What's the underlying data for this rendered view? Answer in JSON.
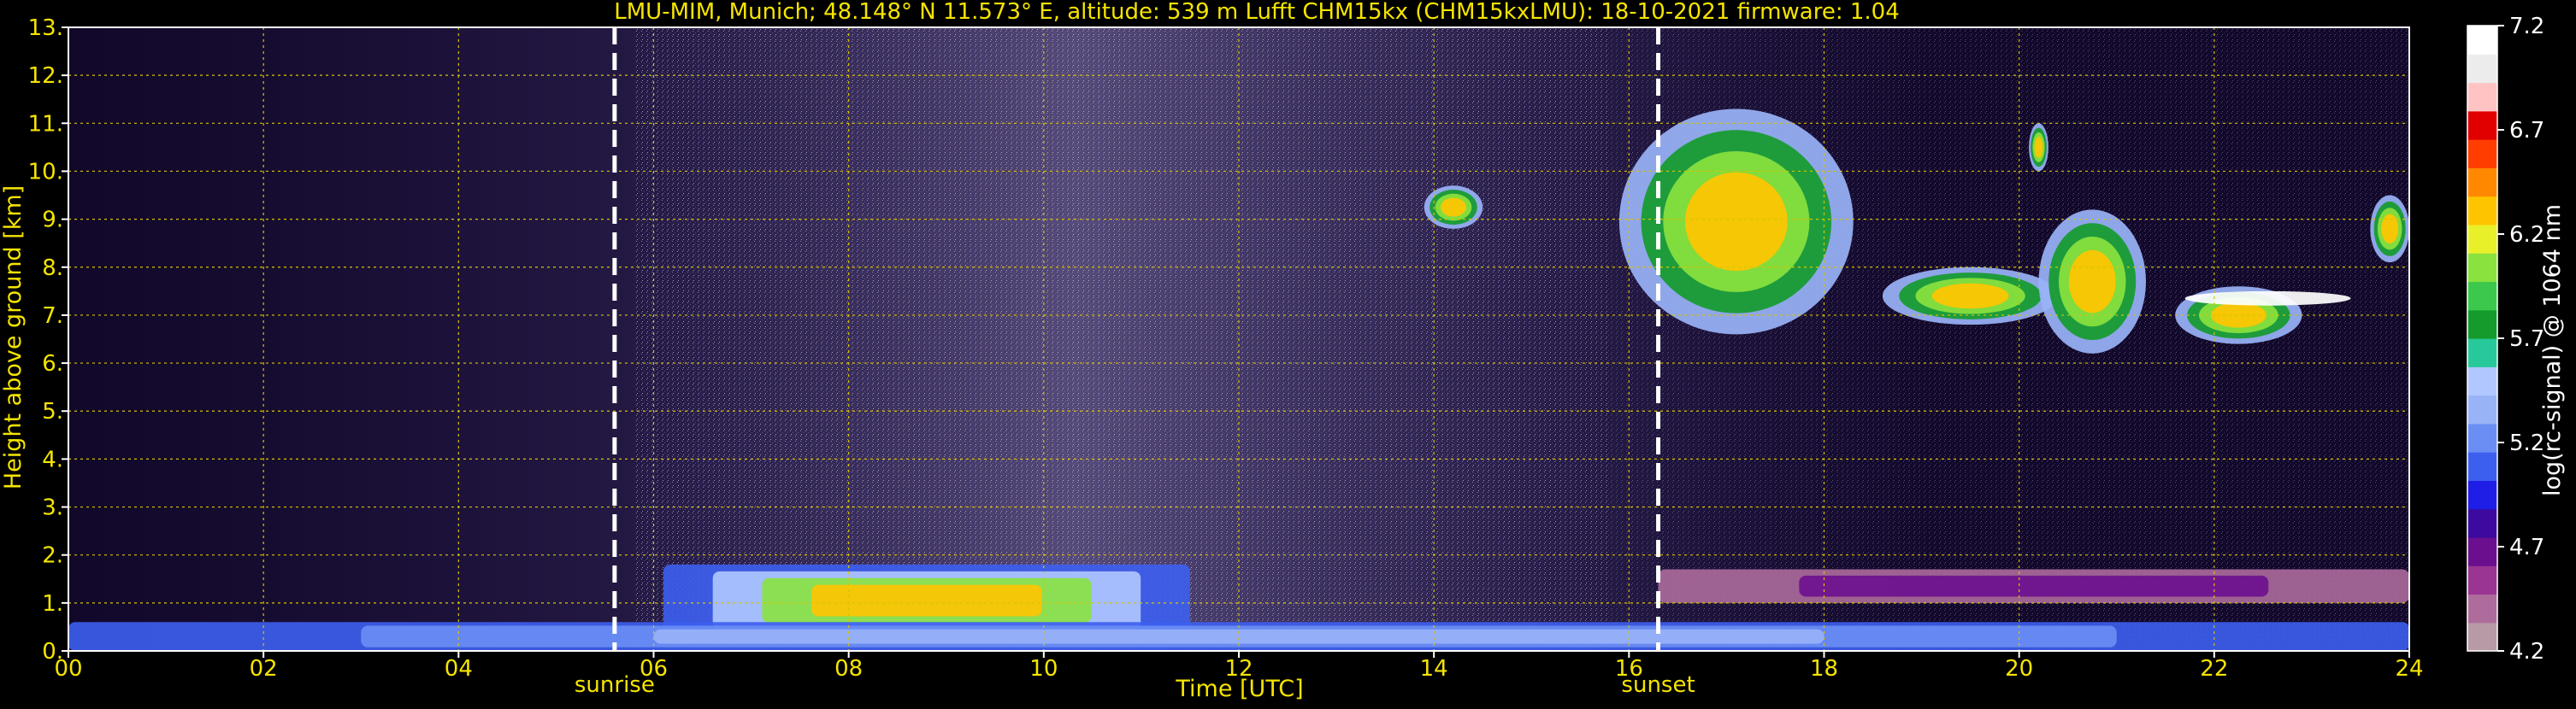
{
  "chart_data": {
    "type": "heatmap",
    "title": "LMU-MIM, Munich; 48.148° N 11.573° E, altitude: 539 m    Lufft CHM15kx (CHM15kxLMU): 18-10-2021    firmware: 1.04",
    "xlabel": "Time [UTC]",
    "ylabel": "Height above ground [km]",
    "xlim": [
      0,
      24
    ],
    "ylim": [
      0,
      13
    ],
    "x_ticks": [
      "00",
      "02",
      "04",
      "06",
      "08",
      "10",
      "12",
      "14",
      "16",
      "18",
      "20",
      "22",
      "24"
    ],
    "y_ticks": [
      "0.",
      "1.",
      "2.",
      "3.",
      "4.",
      "5.",
      "6.",
      "7.",
      "8.",
      "9.",
      "10.",
      "11.",
      "12.",
      "13."
    ],
    "grid": true,
    "colorbar": {
      "label": "log(rc-signal) @ 1064 nm",
      "range": [
        4.2,
        7.2
      ],
      "ticks": [
        "4.2",
        "4.7",
        "5.2",
        "5.7",
        "6.2",
        "6.7",
        "7.2"
      ]
    },
    "markers": [
      {
        "label": "sunrise",
        "time": 5.6
      },
      {
        "label": "sunset",
        "time": 16.3
      }
    ],
    "features": [
      {
        "kind": "boundary layer aerosol",
        "start": 6.1,
        "end": 11.5,
        "bottom": 0.3,
        "top": 1.8
      },
      {
        "kind": "near-surface layer",
        "start": 0.0,
        "end": 24.0,
        "bottom": 0.0,
        "top": 0.6
      },
      {
        "kind": "residual layer",
        "start": 16.3,
        "end": 24.0,
        "bottom": 1.0,
        "top": 1.7
      },
      {
        "kind": "cirrus",
        "start": 15.9,
        "end": 18.3,
        "bottom": 6.6,
        "top": 11.3
      },
      {
        "kind": "cirrus",
        "start": 18.6,
        "end": 20.4,
        "bottom": 6.8,
        "top": 8.0
      },
      {
        "kind": "cirrus",
        "start": 20.2,
        "end": 21.3,
        "bottom": 6.2,
        "top": 9.2
      },
      {
        "kind": "cirrus",
        "start": 20.1,
        "end": 20.3,
        "bottom": 10.0,
        "top": 11.0
      },
      {
        "kind": "cirrus",
        "start": 21.6,
        "end": 22.9,
        "bottom": 6.4,
        "top": 7.6
      },
      {
        "kind": "thin cloud",
        "start": 21.7,
        "end": 23.4,
        "bottom": 7.2,
        "top": 7.5
      },
      {
        "kind": "cirrus",
        "start": 13.9,
        "end": 14.5,
        "bottom": 8.8,
        "top": 9.7
      },
      {
        "kind": "cirrus",
        "start": 23.6,
        "end": 24.0,
        "bottom": 8.1,
        "top": 9.5
      }
    ],
    "palette": [
      "#b79aa6",
      "#ad6c9c",
      "#9b3593",
      "#6b0f8f",
      "#3c0a9e",
      "#1e1ee6",
      "#3d5ff0",
      "#6b8ef4",
      "#99b3f7",
      "#b0c8ff",
      "#27c99a",
      "#159b2c",
      "#3cc84c",
      "#8ae23f",
      "#e8f02a",
      "#ffc400",
      "#ff8800",
      "#ff3d00",
      "#e00000",
      "#ffc3c3",
      "#ececec",
      "#ffffff"
    ]
  }
}
